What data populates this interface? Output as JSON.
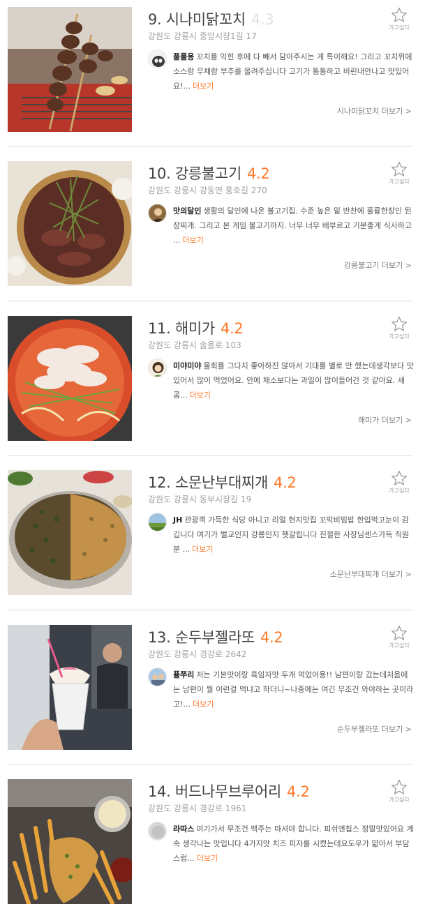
{
  "wishlist_label": "가고싶다",
  "more_label": "더보기",
  "colors": {
    "accent": "#ff792a",
    "rating_faded": "#e0e0e0",
    "divider": "#dedede"
  },
  "restaurants": [
    {
      "title": "9. 시나미닭꼬치",
      "rating": "4.3",
      "address": "강원도 강릉시 중앙시장1길 17",
      "reviewer": "풀룰용",
      "review": "꼬치를 익힌 후에 다 빼서 담아주시는 게 특이해요! 그리고 꼬치위에 소스랑 무채랑 부추를 올려주십니다 고기가 통통하고 비린내안나고 맛있어요!...",
      "more_link": "시나미닭꼬치 더보기 >",
      "photo_icon": "skewer-photo",
      "avatar_icon": "cat-avatar"
    },
    {
      "title": "10. 강릉불고기",
      "rating": "4.2",
      "address": "강원도 강릉시 강동면 풍호길 270",
      "reviewer": "맛의달인",
      "review": "생활의 달인에 나온 불고기집. 수준 높은 밑 반찬에 훌륭한장인 된장찌개. 그리고 본 게임 불고기까지. 너무 너무 배부르고 기분좋게 식사하고 ...",
      "more_link": "강릉불고기 더보기 >",
      "photo_icon": "bulgogi-photo",
      "avatar_icon": "person-avatar"
    },
    {
      "title": "11. 해미가",
      "rating": "4.2",
      "address": "강원도 강릉시 솔올로 103",
      "reviewer": "미야미야",
      "review": "물회를 그다지 좋아하진 않아서 기대를 별로 안 했는데생각보다 맛있어서 많이 먹었어요. 안에 채소보다는 과일이 많이들어간 것 같아요. 새콤...",
      "more_link": "해미가 더보기 >",
      "photo_icon": "mulhoe-photo",
      "avatar_icon": "girl-avatar"
    },
    {
      "title": "12. 소문난부대찌개",
      "rating": "4.2",
      "address": "강원도 강릉시 동부시장길 19",
      "reviewer": "JH",
      "review": "관광객 가득한 식당 아니고 리얼 현지맛집 꼬막비빔밥 한입먹고눈이 감깁니다 여기가 벌교인지 강릉인지 헷갈립니다 친절한 사장님센스가득 직원분 ...",
      "more_link": "소문난부대찌개 더보기 >",
      "photo_icon": "cockle-bibimbap-photo",
      "avatar_icon": "landscape-avatar"
    },
    {
      "title": "13. 순두부젤라또",
      "rating": "4.2",
      "address": "강원도 강릉시 경강로 2642",
      "reviewer": "퓰쭈리",
      "review": "저는 기본맛이랑 흑임자맛 두개 먹었어용!! 남편이랑 갔는데처음에는 남편이 뭘 이런걸 먹냐고 하더니~나중에는 여긴 무조건 와야하는 곳이라고!...",
      "more_link": "순두부젤라또 더보기 >",
      "photo_icon": "gelato-photo",
      "avatar_icon": "family-avatar"
    },
    {
      "title": "14. 버드나무브루어리",
      "rating": "4.2",
      "address": "강원도 강릉시 경강로 1961",
      "reviewer": "라따스",
      "review": "여기가서 무조건 맥주는 마셔야 합니다. 피쉬앤칩스 정말맛있어요 계속 생각나는 맛입니다 4가지맛 치즈 피자를 시켰는데요도우가 얇아서 부담스럽...",
      "more_link": "",
      "photo_icon": "fish-and-chips-photo",
      "avatar_icon": "default-avatar"
    }
  ]
}
